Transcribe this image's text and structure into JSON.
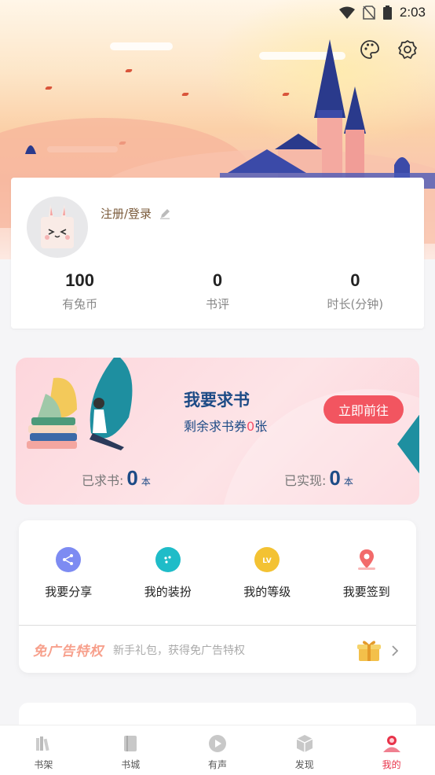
{
  "status_bar": {
    "time": "2:03"
  },
  "header": {
    "theme_icon": "palette-icon",
    "settings_icon": "gear-icon"
  },
  "profile": {
    "login_label": "注册/登录",
    "stats": [
      {
        "value": "100",
        "label": "有兔币"
      },
      {
        "value": "0",
        "label": "书评"
      },
      {
        "value": "0",
        "label": "时长(分钟)"
      }
    ]
  },
  "request_book": {
    "title": "我要求书",
    "subtitle_prefix": "剩余求书券",
    "subtitle_count": "0",
    "subtitle_suffix": "张",
    "button": "立即前往",
    "requested_label": "已求书:",
    "requested_value": "0",
    "requested_unit": "本",
    "fulfilled_label": "已实现:",
    "fulfilled_value": "0",
    "fulfilled_unit": "本"
  },
  "features": [
    {
      "label": "我要分享",
      "icon": "share-icon",
      "color": "#6f7df0"
    },
    {
      "label": "我的装扮",
      "icon": "palette-icon",
      "color": "#1fbcc8"
    },
    {
      "label": "我的等级",
      "icon": "level-icon",
      "color": "#f3c233"
    },
    {
      "label": "我要签到",
      "icon": "location-icon",
      "color": "#f26a6a"
    }
  ],
  "promo": {
    "badge": "免广告特权",
    "text": "新手礼包，获得免广告特权"
  },
  "bottom_nav": [
    {
      "label": "书架",
      "icon": "bookshelf-icon"
    },
    {
      "label": "书城",
      "icon": "book-icon"
    },
    {
      "label": "有声",
      "icon": "play-icon"
    },
    {
      "label": "发现",
      "icon": "cube-icon"
    },
    {
      "label": "我的",
      "icon": "user-icon",
      "active": true
    }
  ],
  "colors": {
    "accent": "#f25560",
    "navy": "#1d4b86",
    "active_nav": "#e8334a"
  }
}
